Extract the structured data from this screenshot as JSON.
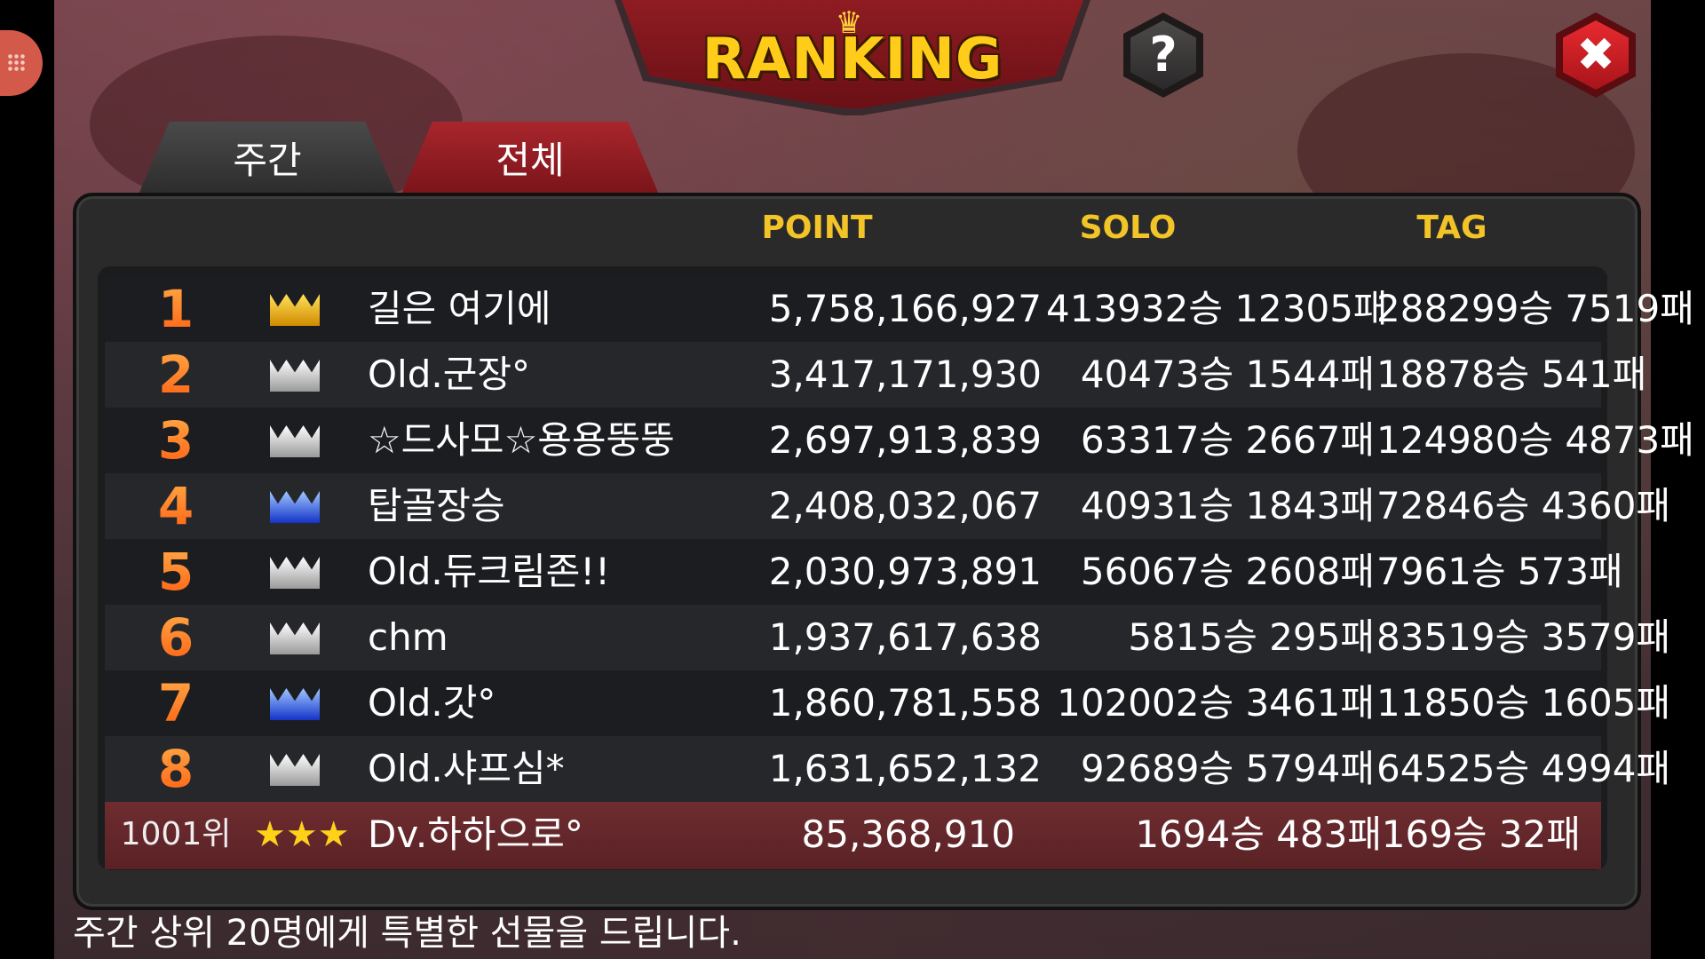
{
  "title": "RANKING",
  "help_label": "?",
  "close_label": "✖",
  "tabs": [
    {
      "label": "주간"
    },
    {
      "label": "전체"
    }
  ],
  "columns": {
    "point": "POINT",
    "solo": "SOLO",
    "tag": "TAG"
  },
  "rows": [
    {
      "rank": "1",
      "crown": "gold-crown-icon",
      "name": "길은 여기에",
      "point": "5,758,166,927",
      "solo": "413932승 12305패",
      "tag": "288299승 7519패"
    },
    {
      "rank": "2",
      "crown": "silver-crown-icon",
      "name": "Old.군장°",
      "point": "3,417,171,930",
      "solo": "40473승 1544패",
      "tag": "18878승 541패"
    },
    {
      "rank": "3",
      "crown": "silver-crown-icon",
      "name": "☆드사모☆용용뚱뚱",
      "point": "2,697,913,839",
      "solo": "63317승 2667패",
      "tag": "124980승 4873패"
    },
    {
      "rank": "4",
      "crown": "blue-crown-icon",
      "name": "탑골장승",
      "point": "2,408,032,067",
      "solo": "40931승 1843패",
      "tag": "72846승 4360패"
    },
    {
      "rank": "5",
      "crown": "silver-crown-icon",
      "name": "Old.듀크림존!!",
      "point": "2,030,973,891",
      "solo": "56067승 2608패",
      "tag": "7961승 573패"
    },
    {
      "rank": "6",
      "crown": "silver-crown-icon",
      "name": "chm",
      "point": "1,937,617,638",
      "solo": "5815승 295패",
      "tag": "83519승 3579패"
    },
    {
      "rank": "7",
      "crown": "blue-crown-icon",
      "name": "Old.갓°",
      "point": "1,860,781,558",
      "solo": "102002승 3461패",
      "tag": "11850승 1605패"
    },
    {
      "rank": "8",
      "crown": "silver-crown-icon",
      "name": "Old.샤프심*",
      "point": "1,631,652,132",
      "solo": "92689승 5794패",
      "tag": "64525승 4994패"
    }
  ],
  "my_row": {
    "rank": "1001위",
    "stars": "★★★",
    "name": "Dv.하하으로°",
    "point": "85,368,910",
    "solo": "1694승 483패",
    "tag": "169승 32패"
  },
  "footer_text": "주간 상위 20명에게 특별한 선물을 드립니다."
}
